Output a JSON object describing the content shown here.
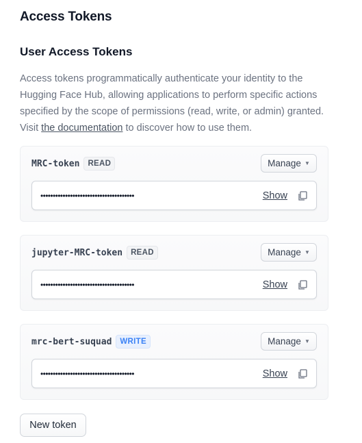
{
  "page": {
    "title": "Access Tokens"
  },
  "section": {
    "title": "User Access Tokens",
    "description_before_link": "Access tokens programmatically authenticate your identity to the Hugging Face Hub, allowing applications to perform specific actions specified by the scope of permissions (read, write, or admin) granted. Visit ",
    "link_text": "the documentation",
    "description_after_link": " to discover how to use them."
  },
  "tokens": [
    {
      "name": "MRC-token",
      "role": "READ",
      "manage_label": "Manage",
      "masked_value": "••••••••••••••••••••••••••••••••••••••",
      "show_label": "Show"
    },
    {
      "name": "jupyter-MRC-token",
      "role": "READ",
      "manage_label": "Manage",
      "masked_value": "••••••••••••••••••••••••••••••••••••••",
      "show_label": "Show"
    },
    {
      "name": "mrc-bert-suquad",
      "role": "WRITE",
      "manage_label": "Manage",
      "masked_value": "••••••••••••••••••••••••••••••••••••••",
      "show_label": "Show"
    }
  ],
  "actions": {
    "new_token_label": "New token"
  },
  "icons": {
    "manage_caret": "chevron-down-icon",
    "copy": "copy-icon"
  },
  "colors": {
    "read_badge": "#4b5563",
    "write_badge": "#3b82f6",
    "description_text": "#6b7280"
  }
}
